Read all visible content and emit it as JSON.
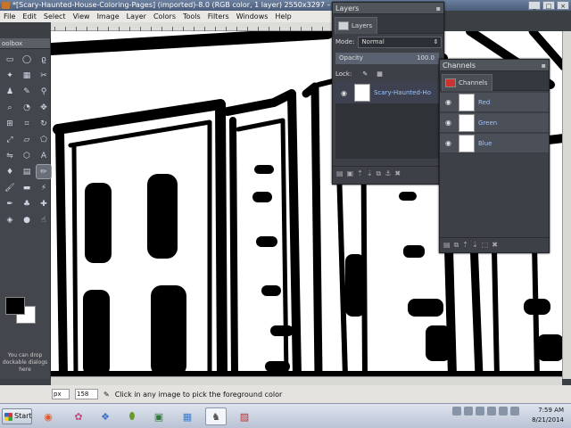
{
  "window": {
    "title": "*[Scary-Haunted-House-Coloring-Pages] (imported)-8.0 (RGB color, 1 layer) 2550x3297 – GIMP",
    "controls": [
      "_",
      "□",
      "×"
    ]
  },
  "menubar": {
    "items": [
      "File",
      "Edit",
      "Select",
      "View",
      "Image",
      "Layer",
      "Colors",
      "Tools",
      "Filters",
      "Windows",
      "Help"
    ]
  },
  "toolbox": {
    "title": "oolbox",
    "tools": [
      {
        "icon": "rect-select-icon",
        "glyph": "▭"
      },
      {
        "icon": "ellipse-select-icon",
        "glyph": "◯"
      },
      {
        "icon": "free-select-icon",
        "glyph": "ϱ"
      },
      {
        "icon": "fuzzy-select-icon",
        "glyph": "✦"
      },
      {
        "icon": "color-select-icon",
        "glyph": "▦"
      },
      {
        "icon": "scissors-icon",
        "glyph": "✂"
      },
      {
        "icon": "foreground-select-icon",
        "glyph": "♟"
      },
      {
        "icon": "paths-icon",
        "glyph": "✎"
      },
      {
        "icon": "color-picker-icon",
        "glyph": "⚲"
      },
      {
        "icon": "zoom-icon",
        "glyph": "⌕"
      },
      {
        "icon": "measure-icon",
        "glyph": "◔"
      },
      {
        "icon": "move-icon",
        "glyph": "✥"
      },
      {
        "icon": "align-icon",
        "glyph": "⊞"
      },
      {
        "icon": "crop-icon",
        "glyph": "⌗"
      },
      {
        "icon": "rotate-icon",
        "glyph": "↻"
      },
      {
        "icon": "scale-icon",
        "glyph": "⤢"
      },
      {
        "icon": "shear-icon",
        "glyph": "▱"
      },
      {
        "icon": "perspective-icon",
        "glyph": "⬠"
      },
      {
        "icon": "flip-icon",
        "glyph": "⇋"
      },
      {
        "icon": "cage-icon",
        "glyph": "⬡"
      },
      {
        "icon": "text-icon",
        "glyph": "A"
      },
      {
        "icon": "bucket-fill-icon",
        "glyph": "♦"
      },
      {
        "icon": "blend-icon",
        "glyph": "▤"
      },
      {
        "icon": "pencil-icon",
        "glyph": "✏"
      },
      {
        "icon": "paintbrush-icon",
        "glyph": "🖌"
      },
      {
        "icon": "eraser-icon",
        "glyph": "▬"
      },
      {
        "icon": "airbrush-icon",
        "glyph": "⚡"
      },
      {
        "icon": "ink-icon",
        "glyph": "✒"
      },
      {
        "icon": "clone-icon",
        "glyph": "♣"
      },
      {
        "icon": "heal-icon",
        "glyph": "✚"
      },
      {
        "icon": "perspective-clone-icon",
        "glyph": "◈"
      },
      {
        "icon": "blur-icon",
        "glyph": "●"
      },
      {
        "icon": "smudge-icon",
        "glyph": "☝"
      }
    ],
    "active_index": 23,
    "hint": "You can drop dockable dialogs here"
  },
  "layers_dock": {
    "title": "Layers",
    "tab": "Layers",
    "mode_label": "Mode:",
    "mode_value": "Normal",
    "opacity_label": "Opacity",
    "opacity_value": "100.0",
    "lock_label": "Lock:",
    "layer_name": "Scary-Haunted-Ho"
  },
  "channels_dock": {
    "title": "Channels",
    "tab": "Channels",
    "channels": [
      "Red",
      "Green",
      "Blue"
    ]
  },
  "statusbar": {
    "unit": "px",
    "zoom": "158",
    "message": "Click in any image to pick the foreground color"
  },
  "taskbar": {
    "start_label": "Start",
    "time": "7:59 AM",
    "date": "8/21/2014"
  },
  "colors": {
    "foreground": "#000000",
    "background": "#ffffff"
  }
}
